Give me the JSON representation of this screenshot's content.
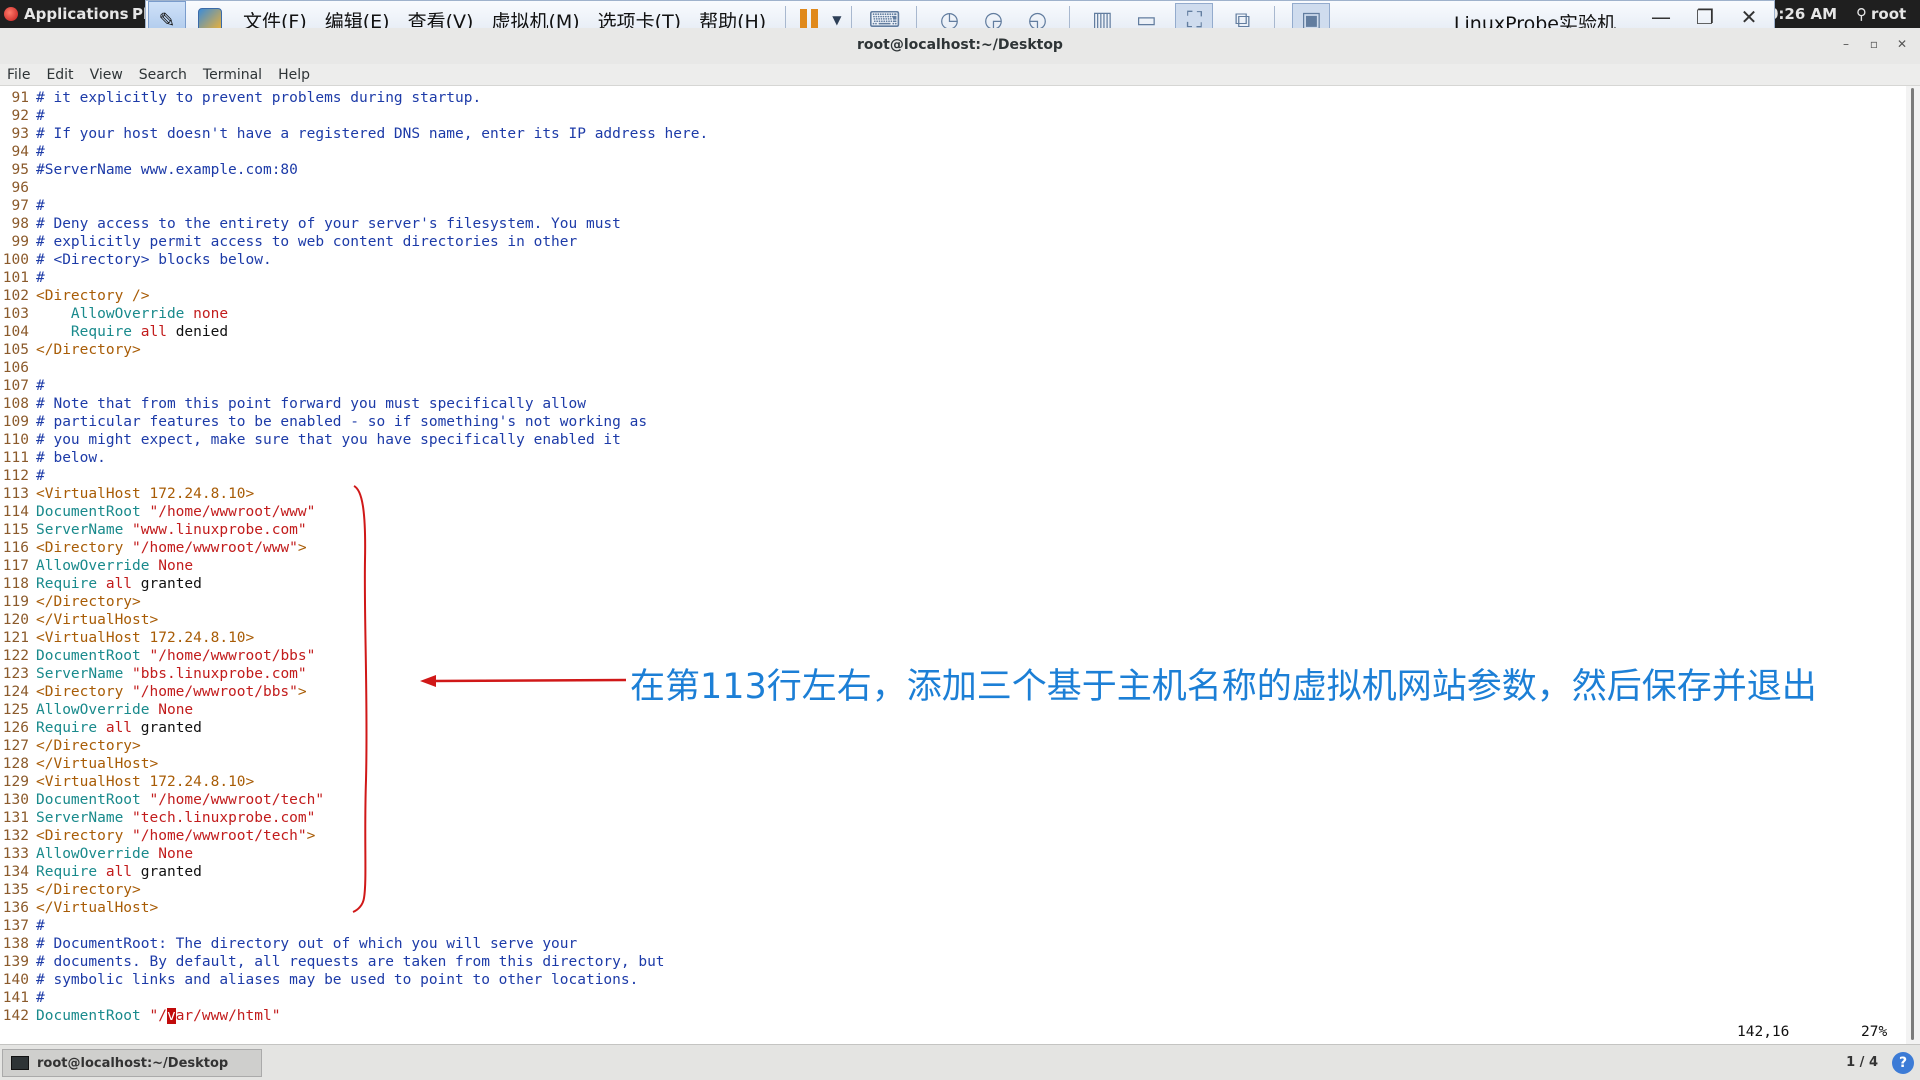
{
  "topbar": {
    "applications": "Applications",
    "places_fragment": "Pl",
    "clock": "0:26 AM",
    "user": "root"
  },
  "vmware": {
    "menu": [
      "文件(F)",
      "编辑(E)",
      "查看(V)",
      "虚拟机(M)",
      "选项卡(T)",
      "帮助(H)"
    ],
    "title": "LinuxProbe实验机"
  },
  "terminal": {
    "title": "root@localhost:~/Desktop",
    "menu": [
      "File",
      "Edit",
      "View",
      "Search",
      "Terminal",
      "Help"
    ]
  },
  "lines": [
    {
      "n": "91",
      "t": "# it explicitly to prevent problems during startup."
    },
    {
      "n": "92",
      "t": "#"
    },
    {
      "n": "93",
      "t": "# If your host doesn't have a registered DNS name, enter its IP address here."
    },
    {
      "n": "94",
      "t": "#"
    },
    {
      "n": "95",
      "t": "#ServerName www.example.com:80"
    },
    {
      "n": "96",
      "t": ""
    },
    {
      "n": "97",
      "t": "#"
    },
    {
      "n": "98",
      "t": "# Deny access to the entirety of your server's filesystem. You must"
    },
    {
      "n": "99",
      "t": "# explicitly permit access to web content directories in other"
    },
    {
      "n": "100",
      "t": "# <Directory> blocks below."
    },
    {
      "n": "101",
      "t": "#"
    },
    {
      "n": "102",
      "t": "<Directory />"
    },
    {
      "n": "103",
      "t": "    AllowOverride none"
    },
    {
      "n": "104",
      "t": "    Require all denied"
    },
    {
      "n": "105",
      "t": "</Directory>"
    },
    {
      "n": "106",
      "t": ""
    },
    {
      "n": "107",
      "t": "#"
    },
    {
      "n": "108",
      "t": "# Note that from this point forward you must specifically allow"
    },
    {
      "n": "109",
      "t": "# particular features to be enabled - so if something's not working as"
    },
    {
      "n": "110",
      "t": "# you might expect, make sure that you have specifically enabled it"
    },
    {
      "n": "111",
      "t": "# below."
    },
    {
      "n": "112",
      "t": "#"
    },
    {
      "n": "113",
      "t": "<VirtualHost 172.24.8.10>"
    },
    {
      "n": "114",
      "t": "DocumentRoot \"/home/wwwroot/www\""
    },
    {
      "n": "115",
      "t": "ServerName \"www.linuxprobe.com\""
    },
    {
      "n": "116",
      "t": "<Directory \"/home/wwwroot/www\">"
    },
    {
      "n": "117",
      "t": "AllowOverride None"
    },
    {
      "n": "118",
      "t": "Require all granted"
    },
    {
      "n": "119",
      "t": "</Directory>"
    },
    {
      "n": "120",
      "t": "</VirtualHost>"
    },
    {
      "n": "121",
      "t": "<VirtualHost 172.24.8.10>"
    },
    {
      "n": "122",
      "t": "DocumentRoot \"/home/wwwroot/bbs\""
    },
    {
      "n": "123",
      "t": "ServerName \"bbs.linuxprobe.com\""
    },
    {
      "n": "124",
      "t": "<Directory \"/home/wwwroot/bbs\">"
    },
    {
      "n": "125",
      "t": "AllowOverride None"
    },
    {
      "n": "126",
      "t": "Require all granted"
    },
    {
      "n": "127",
      "t": "</Directory>"
    },
    {
      "n": "128",
      "t": "</VirtualHost>"
    },
    {
      "n": "129",
      "t": "<VirtualHost 172.24.8.10>"
    },
    {
      "n": "130",
      "t": "DocumentRoot \"/home/wwwroot/tech\""
    },
    {
      "n": "131",
      "t": "ServerName \"tech.linuxprobe.com\""
    },
    {
      "n": "132",
      "t": "<Directory \"/home/wwwroot/tech\">"
    },
    {
      "n": "133",
      "t": "AllowOverride None"
    },
    {
      "n": "134",
      "t": "Require all granted"
    },
    {
      "n": "135",
      "t": "</Directory>"
    },
    {
      "n": "136",
      "t": "</VirtualHost>"
    },
    {
      "n": "137",
      "t": "#"
    },
    {
      "n": "138",
      "t": "# DocumentRoot: The directory out of which you will serve your"
    },
    {
      "n": "139",
      "t": "# documents. By default, all requests are taken from this directory, but"
    },
    {
      "n": "140",
      "t": "# symbolic links and aliases may be used to point to other locations."
    },
    {
      "n": "141",
      "t": "#"
    },
    {
      "n": "142",
      "t": "DocumentRoot \"/var/www/html\""
    }
  ],
  "status": {
    "position": "142,16",
    "percent": "27%"
  },
  "annotation": "在第113行左右，添加三个基于主机名称的虚拟机网站参数，然后保存并退出",
  "taskbar": {
    "item": "root@localhost:~/Desktop",
    "page": "1 / 4"
  },
  "colors": {
    "comment": "#1d3ba8",
    "tag": "#a85c06",
    "directive": "#198a8c",
    "string": "#c21c1c",
    "annotation_text": "#1c7fd6",
    "annotation_mark": "#d01818"
  }
}
